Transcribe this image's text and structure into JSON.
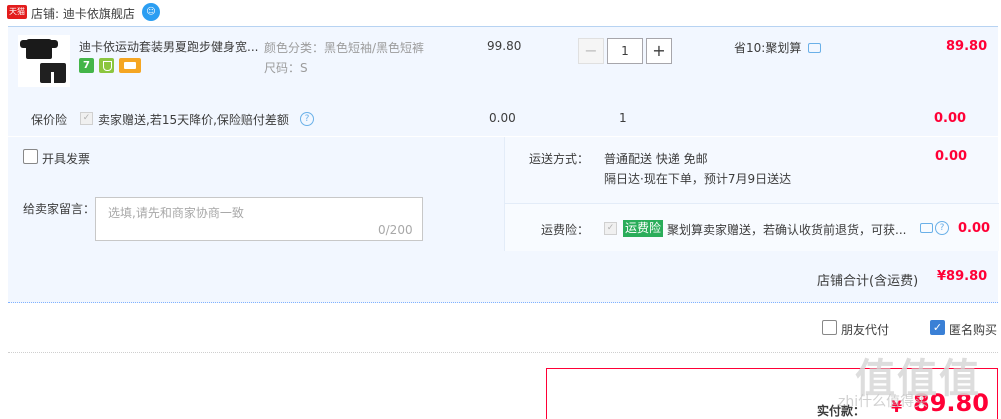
{
  "shop": {
    "logo_text": "天猫",
    "name": "店铺: 迪卡依旗舰店",
    "chat_icon": "wangwang-chat-icon"
  },
  "item": {
    "title": "迪卡依运动套装男夏跑步健身宽...",
    "badges": [
      "7",
      "shield-icon",
      "card-icon"
    ],
    "sku_color": "颜色分类：黑色短袖/黑色短裤",
    "sku_size": "尺码：S",
    "unit_price": "99.80",
    "quantity": "1",
    "qty_minus": "−",
    "qty_plus": "+",
    "promo": "省10:聚划算",
    "total": "89.80"
  },
  "insurance": {
    "label": "保价险",
    "check": "✓",
    "desc": "卖家赠送,若15天降价,保险赔付差额",
    "help": "?",
    "price": "0.00",
    "qty": "1",
    "total": "0.00"
  },
  "options": {
    "invoice_label": "开具发票",
    "message_label": "给卖家留言：",
    "message_placeholder": "选填,请先和商家协商一致",
    "message_count": "0/200"
  },
  "shipping": {
    "label": "运送方式：",
    "line1": "普通配送 快递 免邮",
    "line2": "隔日达·现在下单，预计7月9日送达",
    "total": "0.00"
  },
  "freight": {
    "label": "运费险：",
    "check": "✓",
    "tag": "运费险",
    "desc": "聚划算卖家赠送，若确认收货前退货，可获...",
    "help": "?",
    "total": "0.00"
  },
  "subtotal": {
    "label": "店铺合计(含运费)",
    "value": "¥89.80"
  },
  "checkout": {
    "friend_pay": "朋友代付",
    "anonymous": "匿名购买",
    "anonymous_check": "✓",
    "pay_label": "实付款：",
    "pay_symbol": "¥",
    "pay_amount": "89.80"
  },
  "watermark": {
    "text": "值值值",
    "sub": "zhi什么值得买"
  },
  "colors": {
    "accent_red": "#ff0036",
    "panel_blue": "#f2f7ff",
    "freight_green": "#2aad5a",
    "checkbox_blue": "#3a80d6"
  }
}
